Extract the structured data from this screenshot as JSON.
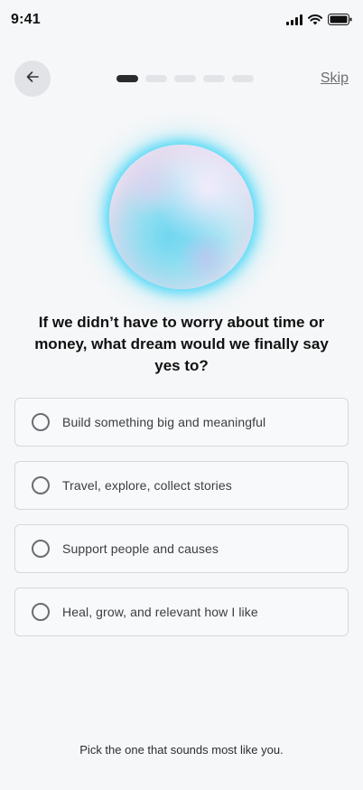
{
  "status_bar": {
    "time": "9:41",
    "icons": [
      "cellular-signal-icon",
      "wifi-icon",
      "battery-icon"
    ]
  },
  "header": {
    "back_icon": "arrow-left-icon",
    "progress": {
      "total_steps": 5,
      "current_step": 1
    },
    "skip_label": "Skip"
  },
  "question": "If we didn’t have to worry about time or money, what dream would we finally say yes to?",
  "options": [
    {
      "label": "Build something big and meaningful"
    },
    {
      "label": "Travel, explore, collect stories"
    },
    {
      "label": "Support people and causes"
    },
    {
      "label": "Heal, grow, and relevant how I like"
    }
  ],
  "hint": "Pick the one that sounds most like you.",
  "colors": {
    "background": "#f6f7f8",
    "accent_glow": "#30d2f5",
    "progress_active": "#2b2b2b",
    "progress_inactive": "#e3e4e7"
  }
}
